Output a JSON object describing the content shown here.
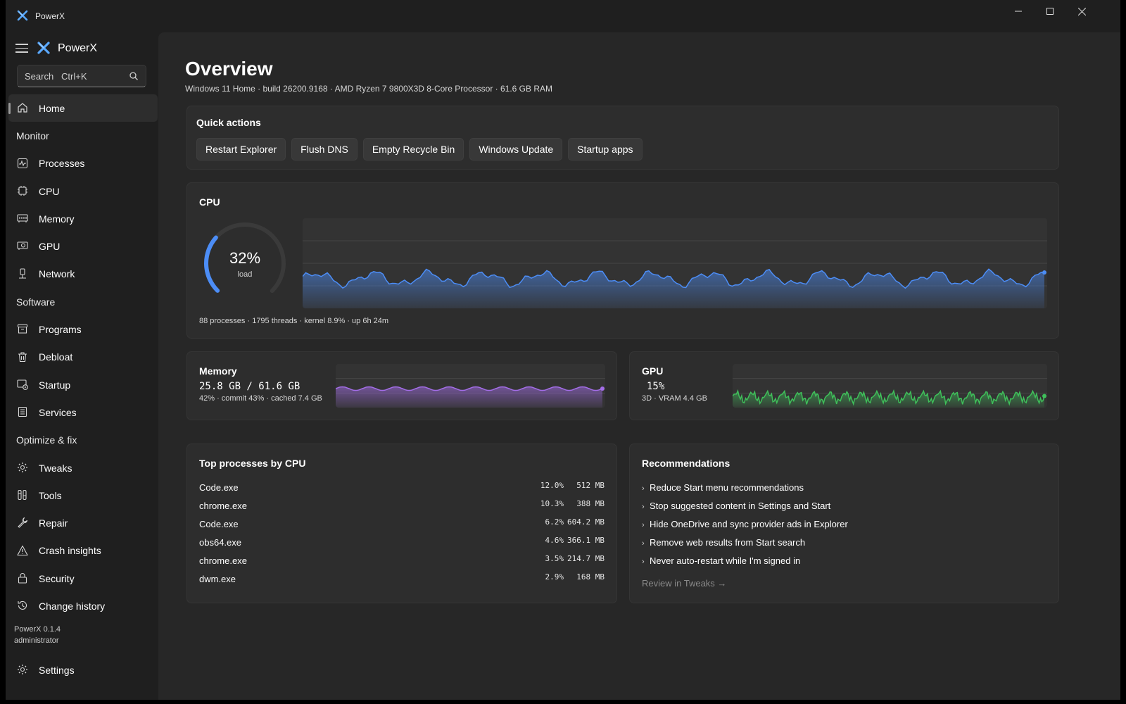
{
  "window": {
    "title": "PowerX"
  },
  "sidebar": {
    "app_name": "PowerX",
    "search_placeholder": "Search   Ctrl+K",
    "home": "Home",
    "groups": {
      "monitor": "Monitor",
      "software": "Software",
      "optimize": "Optimize & fix"
    },
    "monitor_items": [
      "Processes",
      "CPU",
      "Memory",
      "GPU",
      "Network"
    ],
    "software_items": [
      "Programs",
      "Debloat",
      "Startup",
      "Services"
    ],
    "optimize_items": [
      "Tweaks",
      "Tools",
      "Repair",
      "Crash insights",
      "Security",
      "Change history"
    ],
    "version": "PowerX 0.1.4",
    "user": "administrator",
    "settings": "Settings"
  },
  "page": {
    "title": "Overview",
    "subtitle": "Windows 11 Home · build 26200.9168 · AMD Ryzen 7 9800X3D 8-Core Processor · 61.6 GB RAM"
  },
  "quick_actions": {
    "title": "Quick actions",
    "buttons": [
      "Restart Explorer",
      "Flush DNS",
      "Empty Recycle Bin",
      "Windows Update",
      "Startup apps"
    ]
  },
  "cpu": {
    "title": "CPU",
    "load_value": "32%",
    "load_fraction": 0.32,
    "load_label": "load",
    "stats": "88 processes · 1795 threads · kernel 8.9% · up 6h 24m",
    "accent": "#4c8df6"
  },
  "memory": {
    "title": "Memory",
    "usage": "25.8 GB / 61.6 GB",
    "detail": "42% · commit 43% · cached 7.4 GB",
    "accent": "#a46ee8"
  },
  "gpu": {
    "title": "GPU",
    "usage": "15%",
    "detail": "3D · VRAM 4.4 GB",
    "accent": "#3fbf5a"
  },
  "top_processes": {
    "title": "Top processes by CPU",
    "rows": [
      {
        "name": "Code.exe",
        "cpu": "12.0%",
        "mem": "512 MB"
      },
      {
        "name": "chrome.exe",
        "cpu": "10.3%",
        "mem": "388 MB"
      },
      {
        "name": "Code.exe",
        "cpu": "6.2%",
        "mem": "604.2 MB"
      },
      {
        "name": "obs64.exe",
        "cpu": "4.6%",
        "mem": "366.1 MB"
      },
      {
        "name": "chrome.exe",
        "cpu": "3.5%",
        "mem": "214.7 MB"
      },
      {
        "name": "dwm.exe",
        "cpu": "2.9%",
        "mem": "168 MB"
      }
    ]
  },
  "recommendations": {
    "title": "Recommendations",
    "items": [
      "Reduce Start menu recommendations",
      "Stop suggested content in Settings and Start",
      "Hide OneDrive and sync provider ads in Explorer",
      "Remove web results from Start search",
      "Never auto-restart while I'm signed in"
    ],
    "link": "Review in Tweaks →"
  }
}
